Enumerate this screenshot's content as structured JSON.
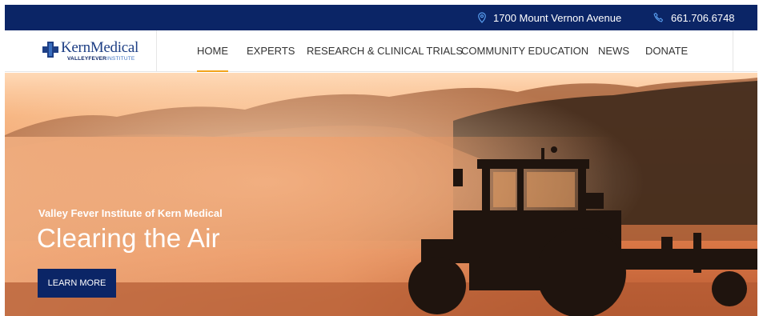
{
  "topbar": {
    "address": "1700 Mount Vernon Avenue",
    "phone": "661.706.6748",
    "address_icon": "map-pin-icon",
    "phone_icon": "phone-icon"
  },
  "logo": {
    "name": "KernMedical",
    "sub_bold": "VALLEYFEVER",
    "sub_light": "INSTITUTE"
  },
  "nav": {
    "items": [
      {
        "label": "HOME",
        "active": true
      },
      {
        "label": "EXPERTS"
      },
      {
        "label": "RESEARCH & CLINICAL TRIALS"
      },
      {
        "label": "COMMUNITY EDUCATION"
      },
      {
        "label": "NEWS"
      },
      {
        "label": "DONATE"
      }
    ]
  },
  "hero": {
    "eyebrow": "Valley Fever Institute of Kern Medical",
    "title": "Clearing the Air",
    "cta": "LEARN MORE"
  },
  "colors": {
    "brand_navy": "#0b2566",
    "active_underline": "#f2a41a"
  }
}
